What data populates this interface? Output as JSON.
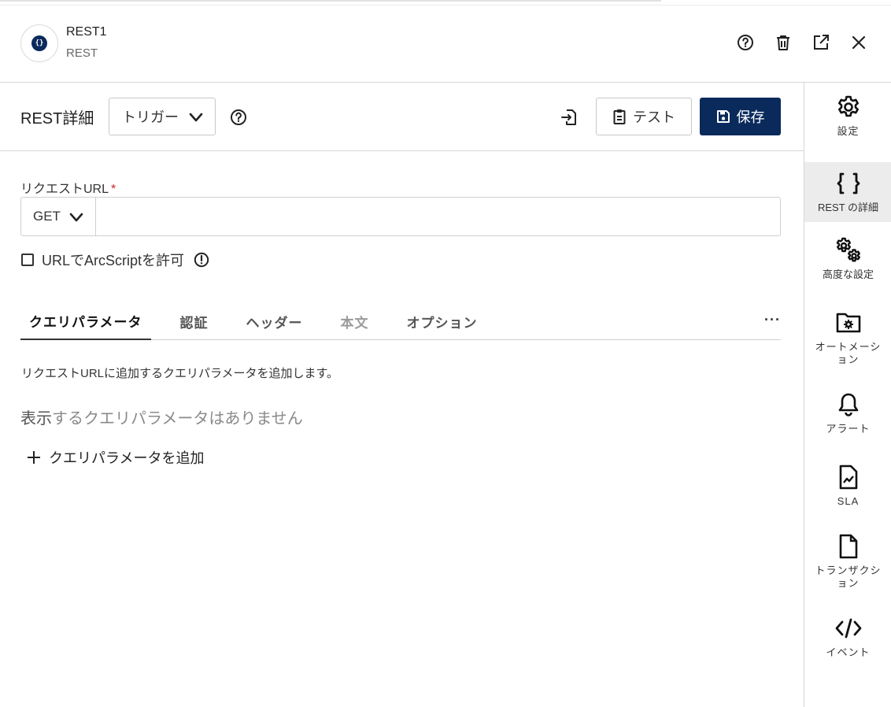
{
  "header": {
    "title": "REST1",
    "subtitle": "REST",
    "avatar_icon": "curly-braces-icon"
  },
  "toolbar": {
    "title": "REST詳細",
    "trigger_select": "トリガー",
    "test_label": "テスト",
    "save_label": "保存"
  },
  "request": {
    "url_label": "リクエストURL",
    "required_mark": "*",
    "method": "GET",
    "url_value": "",
    "allow_arcscript_label": "URLでArcScriptを許可"
  },
  "tabs": [
    {
      "label": "クエリパラメータ",
      "state": "active"
    },
    {
      "label": "認証",
      "state": "normal"
    },
    {
      "label": "ヘッダー",
      "state": "normal"
    },
    {
      "label": "本文",
      "state": "disabled"
    },
    {
      "label": "オプション",
      "state": "normal"
    }
  ],
  "tabs_more": "···",
  "query": {
    "description": "リクエストURLに追加するクエリパラメータを追加します。",
    "empty_lead": "表示",
    "empty_rest": "するクエリパラメータはありません",
    "add_label": "クエリパラメータを追加"
  },
  "rail": [
    {
      "label": "設定",
      "icon": "gear-icon"
    },
    {
      "label": "REST の詳細",
      "icon": "curly-braces-icon"
    },
    {
      "label": "高度な設定",
      "icon": "gears-icon"
    },
    {
      "label": "オートメーション",
      "icon": "folder-gear-icon"
    },
    {
      "label": "アラート",
      "icon": "bell-icon"
    },
    {
      "label": "SLA",
      "icon": "chart-document-icon"
    },
    {
      "label": "トランザクション",
      "icon": "document-icon"
    },
    {
      "label": "イベント",
      "icon": "code-icon"
    }
  ],
  "colors": {
    "primary": "#0a2a5c",
    "required": "#c62828",
    "active_rail_bg": "#ececec"
  }
}
